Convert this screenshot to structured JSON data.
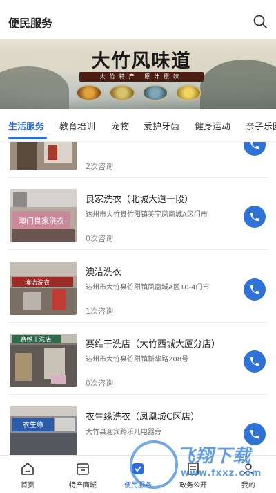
{
  "header": {
    "title": "便民服务"
  },
  "banner": {
    "brand": "大竹风味道",
    "sub": "大竹特产 原汁原味"
  },
  "tabs": [
    {
      "label": "生活服务",
      "active": true
    },
    {
      "label": "教育培训"
    },
    {
      "label": "宠物"
    },
    {
      "label": "爱护牙齿"
    },
    {
      "label": "健身运动"
    },
    {
      "label": "亲子乐园"
    }
  ],
  "items": [
    {
      "name": "",
      "address": "",
      "count": "2次咨询"
    },
    {
      "name": "良家洗衣（北城大道一段）",
      "address": "达州市大竹县竹阳镇美宇凤凰城A区门市",
      "count": "0次咨询"
    },
    {
      "name": "澳洁洗衣",
      "address": "达州市大竹县竹阳镇凤凰城A区10-4门市",
      "count": "1次咨询"
    },
    {
      "name": "赛维干洗店（大竹西城大厦分店）",
      "address": "达州市大竹县竹阳镇新华路208号",
      "count": "0次咨询"
    },
    {
      "name": "衣生缘洗衣（凤凰城C区店）",
      "address": "大竹县迎宾路乐儿电器旁",
      "count": ""
    }
  ],
  "thumb_signs": [
    "",
    "澳门良家洗衣",
    "澳洁洗衣",
    "赛维干洗店",
    "衣生缘"
  ],
  "bottom_nav": [
    {
      "label": "首页",
      "icon": "home-icon"
    },
    {
      "label": "特产商城",
      "icon": "shop-icon"
    },
    {
      "label": "便民服务",
      "icon": "service-icon",
      "active": true
    },
    {
      "label": "政务公开",
      "icon": "gov-icon"
    },
    {
      "label": "我的",
      "icon": "user-icon"
    }
  ],
  "watermark": {
    "text": "飞翔下载",
    "url": "www.fxxz.com"
  },
  "colors": {
    "accent": "#2b6dde",
    "call_button": "#2f73d9"
  }
}
